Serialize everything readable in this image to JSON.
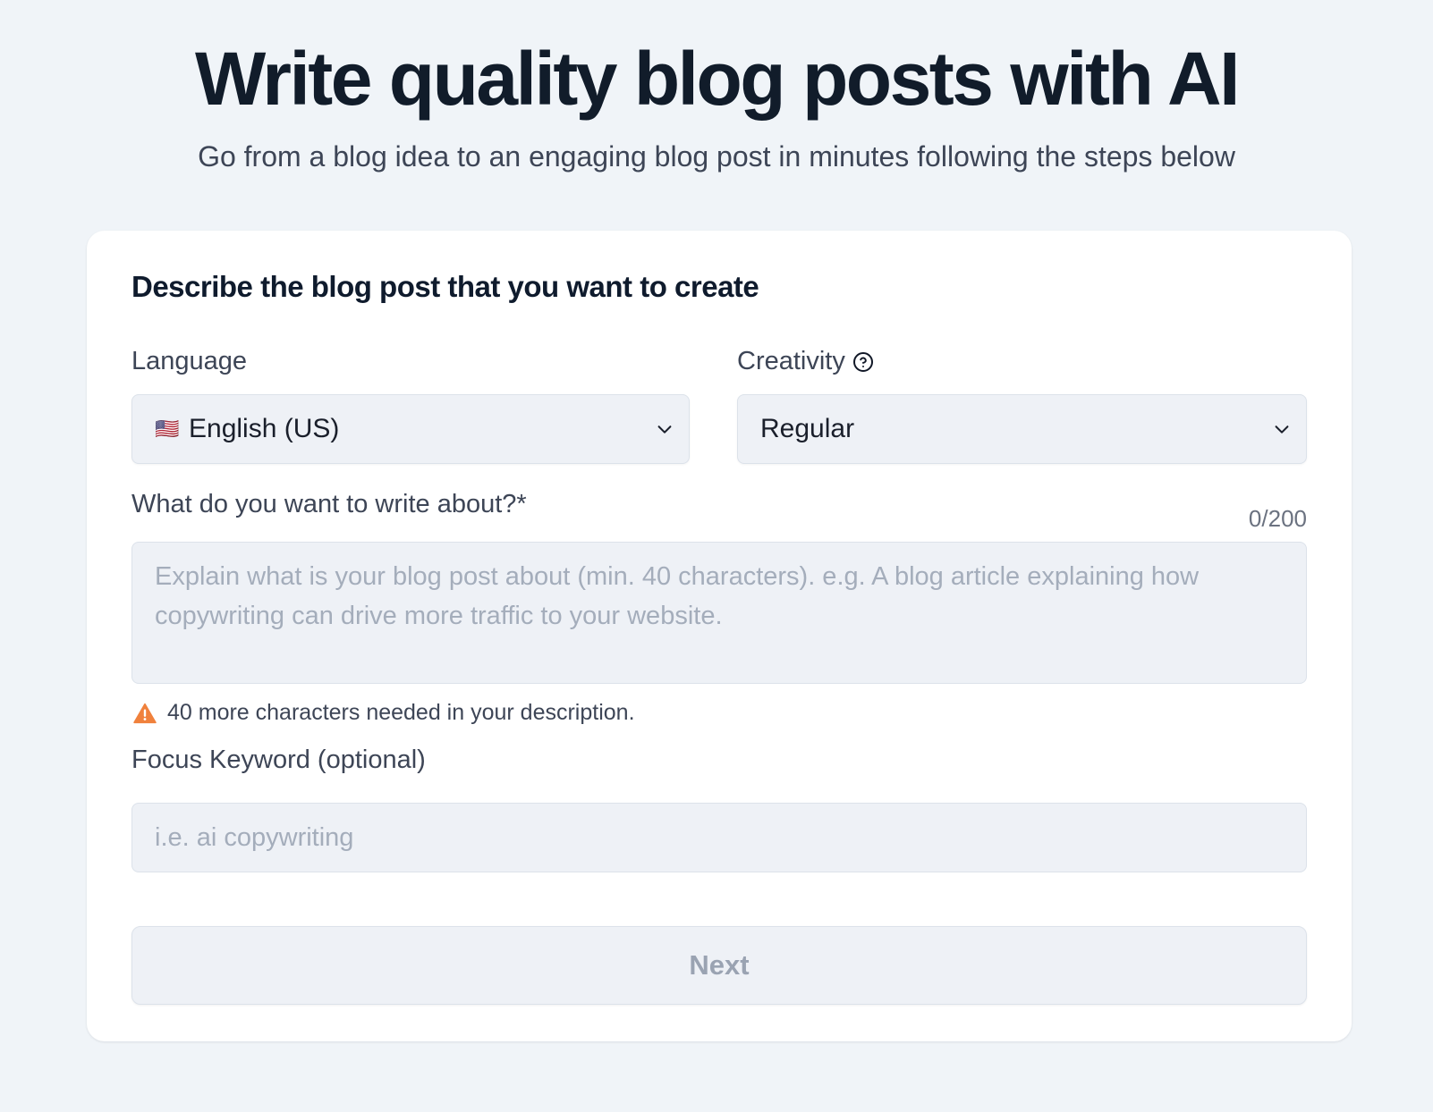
{
  "header": {
    "title": "Write quality blog posts with AI",
    "subtitle": "Go from a blog idea to an engaging blog post in minutes following the steps below"
  },
  "form": {
    "heading": "Describe the blog post that you want to create",
    "language": {
      "label": "Language",
      "flag": "🇺🇸",
      "selected": "English (US)"
    },
    "creativity": {
      "label": "Creativity",
      "help_icon": "question-circle-icon",
      "selected": "Regular"
    },
    "topic": {
      "label": "What do you want to write about?*",
      "counter": "0/200",
      "placeholder": "Explain what is your blog post about (min. 40 characters). e.g. A blog article explaining how copywriting can drive more traffic to your website.",
      "value": ""
    },
    "warning": {
      "icon": "warning-triangle-icon",
      "text": "40 more characters needed in your description."
    },
    "keyword": {
      "label": "Focus Keyword (optional)",
      "placeholder": "i.e. ai copywriting",
      "value": ""
    },
    "next_label": "Next"
  },
  "colors": {
    "background": "#f0f4f8",
    "card": "#ffffff",
    "field": "#eef1f6",
    "warning": "#f0813c",
    "disabled_text": "#9aa3b2"
  }
}
